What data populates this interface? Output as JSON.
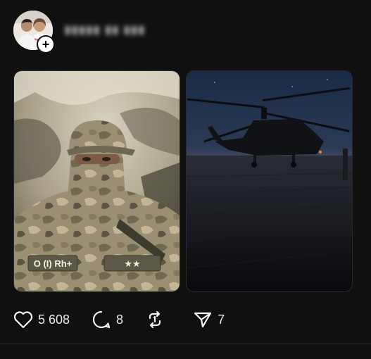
{
  "post": {
    "username": "▮▮▮▮▮ ▮▮ ▮▮▮",
    "avatar_icon": "profile-photo",
    "follow_icon": "plus-icon",
    "follow_symbol": "+"
  },
  "media": [
    {
      "alt": "selfie-in-camouflage",
      "patch_text": "O (I) Rh+",
      "rank_text": "★★"
    },
    {
      "alt": "helicopter-at-dusk"
    }
  ],
  "actions": {
    "likes": "5 608",
    "comments": "8",
    "shares": "7"
  },
  "colors": {
    "background": "#101010",
    "text": "#f3f5f7",
    "divider": "#2b2b2b"
  }
}
